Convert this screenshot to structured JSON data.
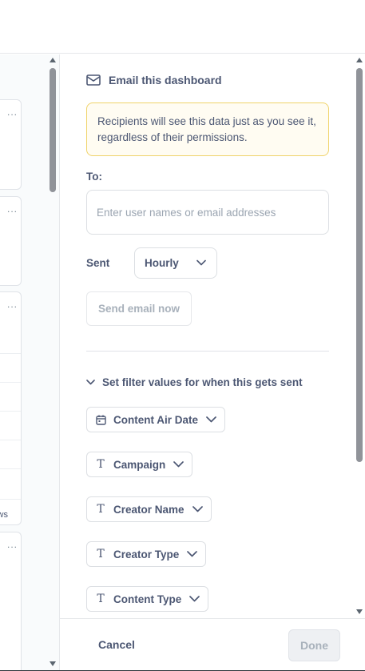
{
  "panel": {
    "title": "Email this dashboard",
    "notice": "Recipients will see this data just as you see it, regardless of their permissions.",
    "to_label": "To:",
    "to_placeholder": "Enter user names or email addresses",
    "to_value": "",
    "sent_label": "Sent",
    "frequency": "Hourly",
    "send_now_label": "Send email now",
    "filters_toggle_label": "Set filter values for when this gets sent",
    "filters": [
      {
        "label": "Content Air Date",
        "icon": "calendar-icon"
      },
      {
        "label": "Campaign",
        "icon": "text-type-icon"
      },
      {
        "label": "Creator Name",
        "icon": "text-type-icon"
      },
      {
        "label": "Creator Type",
        "icon": "text-type-icon"
      },
      {
        "label": "Content Type",
        "icon": "text-type-icon"
      }
    ]
  },
  "footer": {
    "cancel_label": "Cancel",
    "done_label": "Done"
  },
  "background": {
    "card_text": "ws",
    "card_menu": "..."
  },
  "colors": {
    "text": "#4c5773",
    "muted": "#a8b1bb",
    "notice_bg": "#fffcf2",
    "notice_border": "#f0d36a",
    "border": "#dcdfe3"
  }
}
